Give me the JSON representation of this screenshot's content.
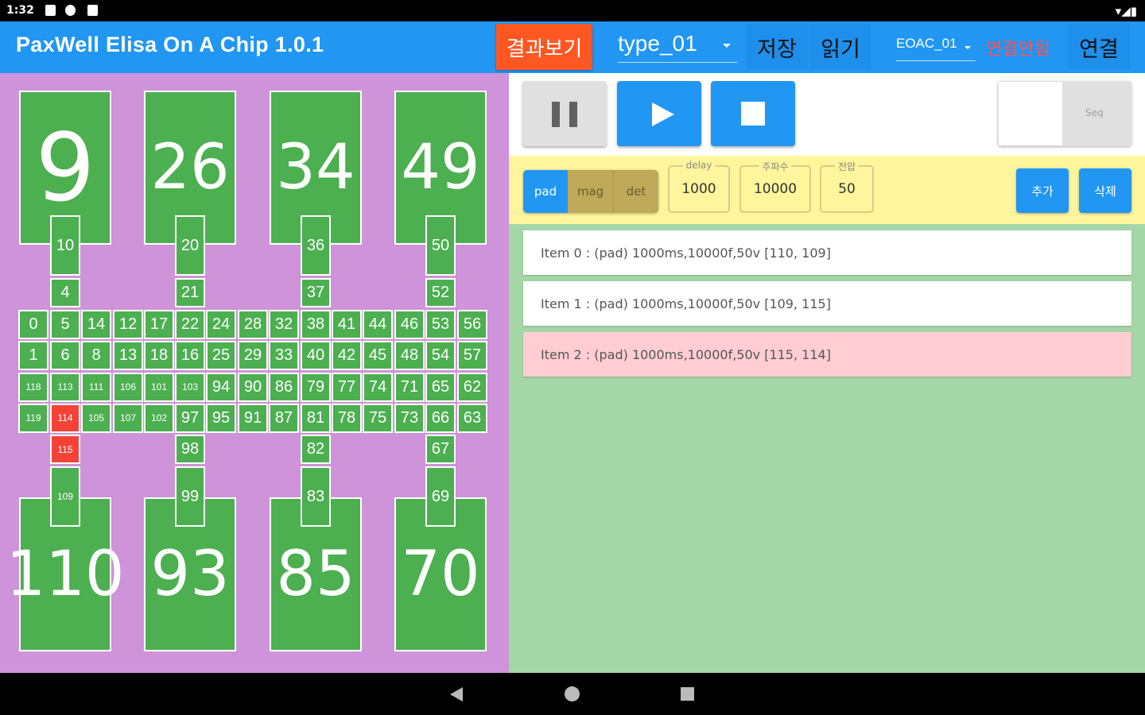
{
  "status_bar": {
    "time": "1:32"
  },
  "app_bar": {
    "title": "PaxWell Elisa On A Chip 1.0.1",
    "results_button": "결과보기",
    "type_select": "type_01",
    "save_button": "저장",
    "load_button": "읽기",
    "device_select": "EOAC_01",
    "connection_status": "연결안됨",
    "connect_button": "연결"
  },
  "chip": {
    "top_pads": [
      "9",
      "26",
      "34",
      "49"
    ],
    "top_stems": [
      [
        "10",
        "4"
      ],
      [
        "20",
        "21"
      ],
      [
        "36",
        "37"
      ],
      [
        "50",
        "52"
      ]
    ],
    "grid_rows": [
      [
        "0",
        "5",
        "14",
        "12",
        "17",
        "22",
        "24",
        "28",
        "32",
        "38",
        "41",
        "44",
        "46",
        "53",
        "56"
      ],
      [
        "1",
        "6",
        "8",
        "13",
        "18",
        "16",
        "25",
        "29",
        "33",
        "40",
        "42",
        "45",
        "48",
        "54",
        "57"
      ],
      [
        "118",
        "113",
        "111",
        "106",
        "101",
        "103",
        "94",
        "90",
        "86",
        "79",
        "77",
        "74",
        "71",
        "65",
        "62"
      ],
      [
        "119",
        "114",
        "105",
        "107",
        "102",
        "97",
        "95",
        "91",
        "87",
        "81",
        "78",
        "75",
        "73",
        "66",
        "63"
      ]
    ],
    "highlighted": [
      "114",
      "115"
    ],
    "bottom_stems": [
      [
        "115",
        "109"
      ],
      [
        "98",
        "99"
      ],
      [
        "82",
        "83"
      ],
      [
        "67",
        "69"
      ]
    ],
    "bottom_pads": [
      "110",
      "93",
      "85",
      "70"
    ]
  },
  "controls": {
    "toggle_label": "Seq",
    "toggle_on": false
  },
  "params": {
    "modes": [
      "pad",
      "mag",
      "det"
    ],
    "selected_mode": "pad",
    "delay_label": "delay",
    "delay_value": "1000",
    "freq_label": "주파수",
    "freq_value": "10000",
    "voltage_label": "전압",
    "voltage_value": "50",
    "add_button": "추가",
    "delete_button": "삭제"
  },
  "sequence": [
    {
      "text": "Item 0 : (pad) 1000ms,10000f,50v  [110, 109]",
      "selected": false
    },
    {
      "text": "Item 1 : (pad) 1000ms,10000f,50v  [109, 115]",
      "selected": false
    },
    {
      "text": "Item 2 : (pad) 1000ms,10000f,50v  [115, 114]",
      "selected": true
    }
  ],
  "colors": {
    "app_bar": "#2196F3",
    "cell": "#4CAF50",
    "cell_active": "#F44336",
    "left_bg": "#CE93D8",
    "right_bg": "#A5D6A7",
    "params_bg": "#FFF59D",
    "results_button": "#FF5722"
  }
}
